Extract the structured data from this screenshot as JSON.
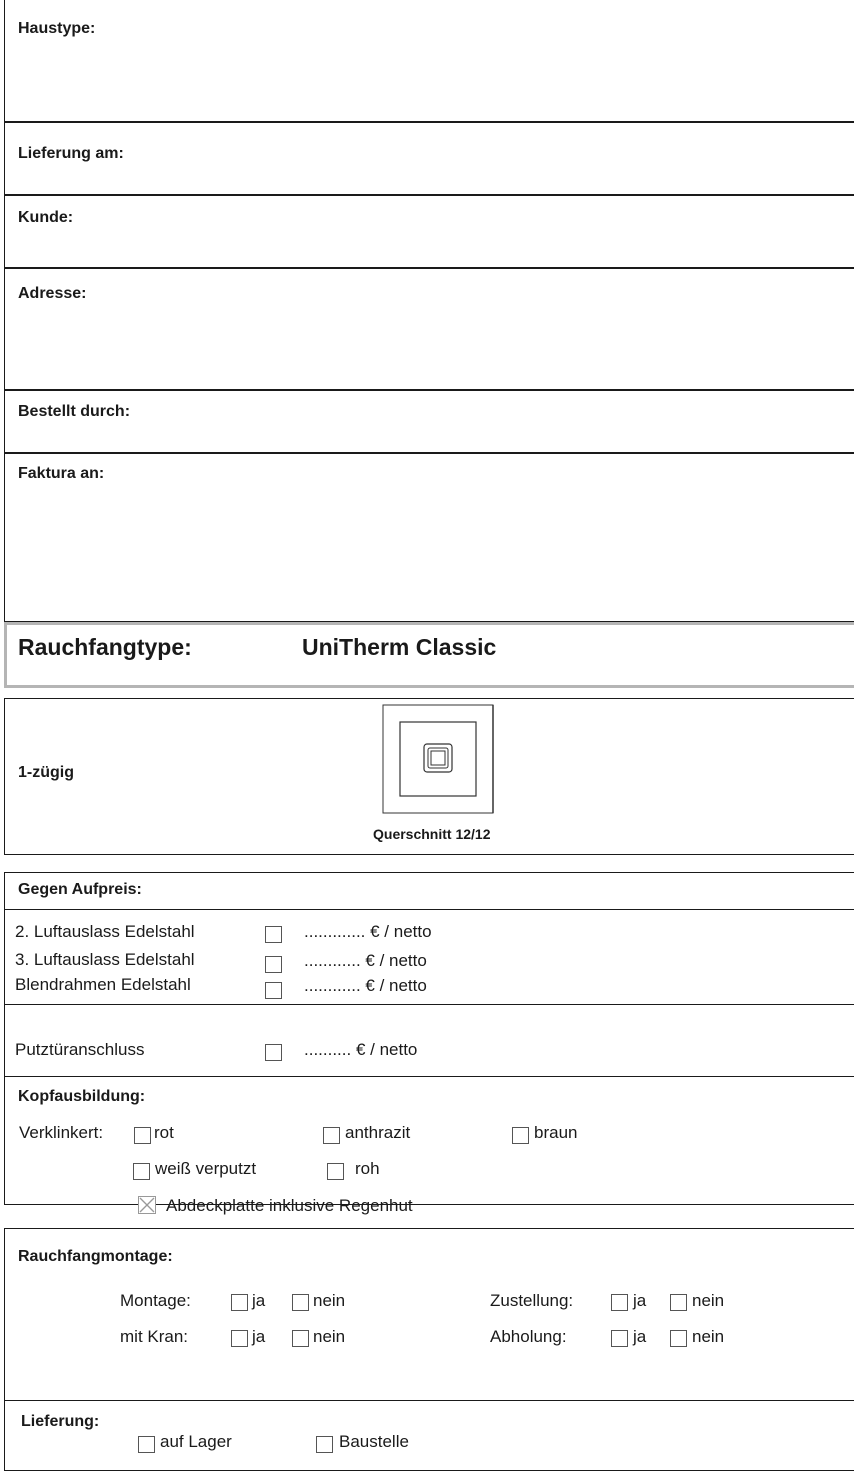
{
  "header": {
    "haustype": "Haustype:",
    "lieferung_am": "Lieferung am:",
    "kunde": "Kunde:",
    "adresse": "Adresse:",
    "bestellt_durch": "Bestellt durch:",
    "faktura_an": "Faktura an:"
  },
  "rauchfang": {
    "label": "Rauchfangtype:",
    "value": "UniTherm Classic"
  },
  "zug": {
    "label": "1-zügig",
    "caption": "Querschnitt 12/12"
  },
  "aufpreis": {
    "title": "Gegen Aufpreis:",
    "items": [
      {
        "label": "2. Luftauslass Edelstahl",
        "price": "............. € / netto"
      },
      {
        "label": "3. Luftauslass Edelstahl",
        "price": "............ € / netto"
      },
      {
        "label": "Blendrahmen Edelstahl",
        "price": "............ € / netto"
      },
      {
        "label": "Putztüranschluss",
        "price": ".......... € / netto"
      }
    ]
  },
  "kopf": {
    "title": "Kopfausbildung:",
    "verklinkert": "Verklinkert:",
    "rot": "rot",
    "anthrazit": "anthrazit",
    "braun": "braun",
    "weiss": "weiß verputzt",
    "roh": "roh",
    "abdeck": "Abdeckplatte inklusive Regenhut"
  },
  "montage": {
    "title": "Rauchfangmontage:",
    "montage": "Montage:",
    "kran": "mit Kran:",
    "zustellung": "Zustellung:",
    "abholung": "Abholung:",
    "ja": "ja",
    "nein": "nein"
  },
  "lieferung": {
    "title": "Lieferung:",
    "lager": "auf Lager",
    "baustelle": "Baustelle"
  },
  "colors": {
    "border": "#1a1a1a",
    "grey_border": "#b5b5b5",
    "checked_x": "#999999"
  }
}
